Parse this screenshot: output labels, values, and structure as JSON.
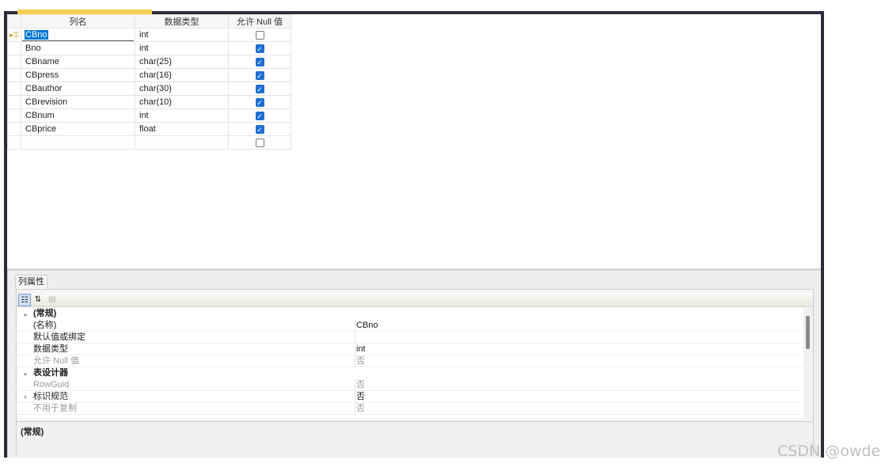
{
  "table": {
    "headers": [
      "列名",
      "数据类型",
      "允许 Null 值"
    ],
    "rows": [
      {
        "name": "CBno",
        "type": "int",
        "nullable": false,
        "selected": true
      },
      {
        "name": "Bno",
        "type": "int",
        "nullable": true
      },
      {
        "name": "CBname",
        "type": "char(25)",
        "nullable": true
      },
      {
        "name": "CBpress",
        "type": "char(16)",
        "nullable": true
      },
      {
        "name": "CBauthor",
        "type": "char(30)",
        "nullable": true
      },
      {
        "name": "CBrevision",
        "type": "char(10)",
        "nullable": true
      },
      {
        "name": "CBnum",
        "type": "int",
        "nullable": true
      },
      {
        "name": "CBprice",
        "type": "float",
        "nullable": true
      },
      {
        "name": "",
        "type": "",
        "nullable": false
      }
    ]
  },
  "properties": {
    "tab_label": "列属性",
    "toolbar": [
      "categorized-icon",
      "alphabetical-sort-icon",
      "property-pages-icon"
    ],
    "groups": [
      {
        "kind": "category",
        "label": "(常规)",
        "expander": "⌄"
      },
      {
        "kind": "item",
        "label": "(名称)",
        "value": "CBno"
      },
      {
        "kind": "item",
        "label": "默认值或绑定",
        "value": ""
      },
      {
        "kind": "item",
        "label": "数据类型",
        "value": "int"
      },
      {
        "kind": "item",
        "label": "允许 Null 值",
        "value": "否",
        "grey": true
      },
      {
        "kind": "category",
        "label": "表设计器",
        "expander": "⌄"
      },
      {
        "kind": "item",
        "label": "RowGuid",
        "value": "否",
        "grey": true
      },
      {
        "kind": "item",
        "label": "标识规范",
        "value": "否",
        "expander": "›"
      },
      {
        "kind": "item",
        "label": "不用于复制",
        "value": "否",
        "grey": true
      }
    ],
    "description_title": "(常规)"
  },
  "colors": {
    "frame": "#2b2b3c",
    "active_tab": "#f4cf4c",
    "checkbox_on": "#1e6fd0",
    "selection": "#0078d7"
  },
  "watermark": "CSDN @owde"
}
